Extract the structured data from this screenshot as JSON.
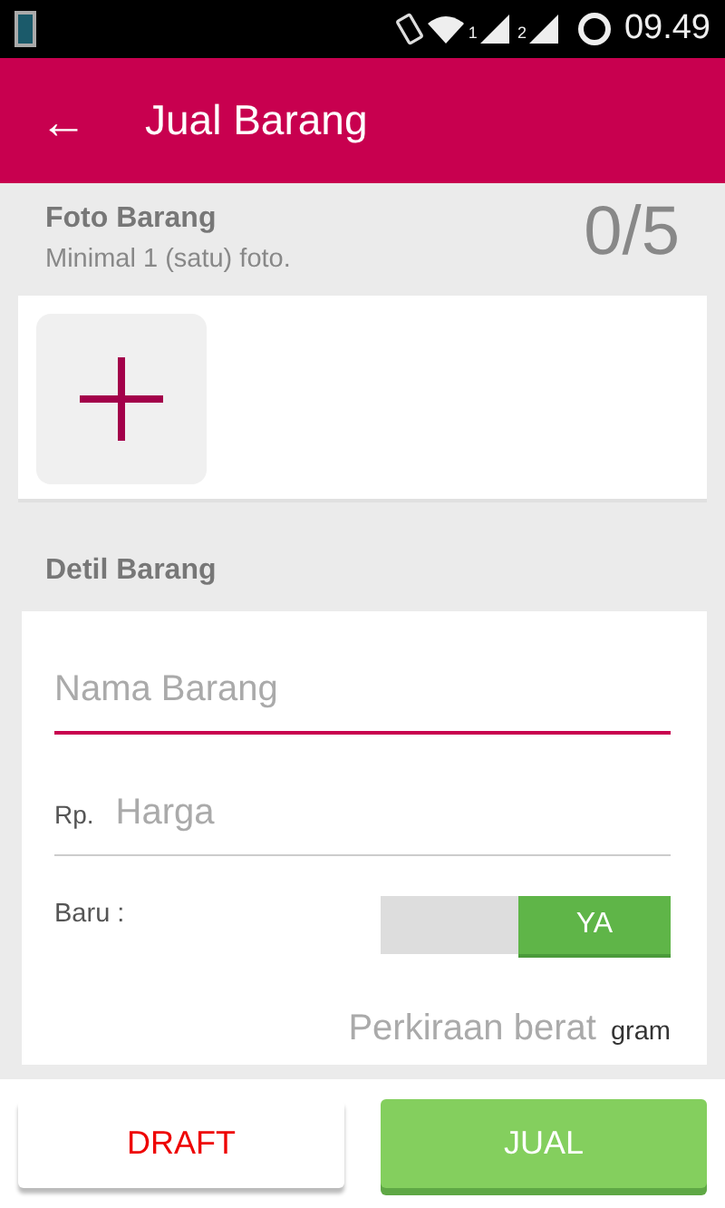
{
  "status_bar": {
    "sim_labels": [
      "1",
      "2"
    ],
    "time": "09.49"
  },
  "app_bar": {
    "back": "←",
    "title": "Jual Barang"
  },
  "photos": {
    "title": "Foto Barang",
    "subtitle": "Minimal 1 (satu) foto.",
    "count": "0/5"
  },
  "details": {
    "title": "Detil Barang",
    "name_field": {
      "placeholder": "Nama Barang",
      "focused": true
    },
    "price_field": {
      "prefix": "Rp.",
      "placeholder": "Harga"
    },
    "new_toggle": {
      "label": "Baru :",
      "on_label": "YA",
      "on": true
    },
    "weight_field": {
      "placeholder": "Perkiraan berat",
      "unit": "gram"
    }
  },
  "buttons": [
    {
      "label": "DRAFT",
      "kind": "secondary"
    },
    {
      "label": "JUAL",
      "kind": "primary"
    }
  ]
}
